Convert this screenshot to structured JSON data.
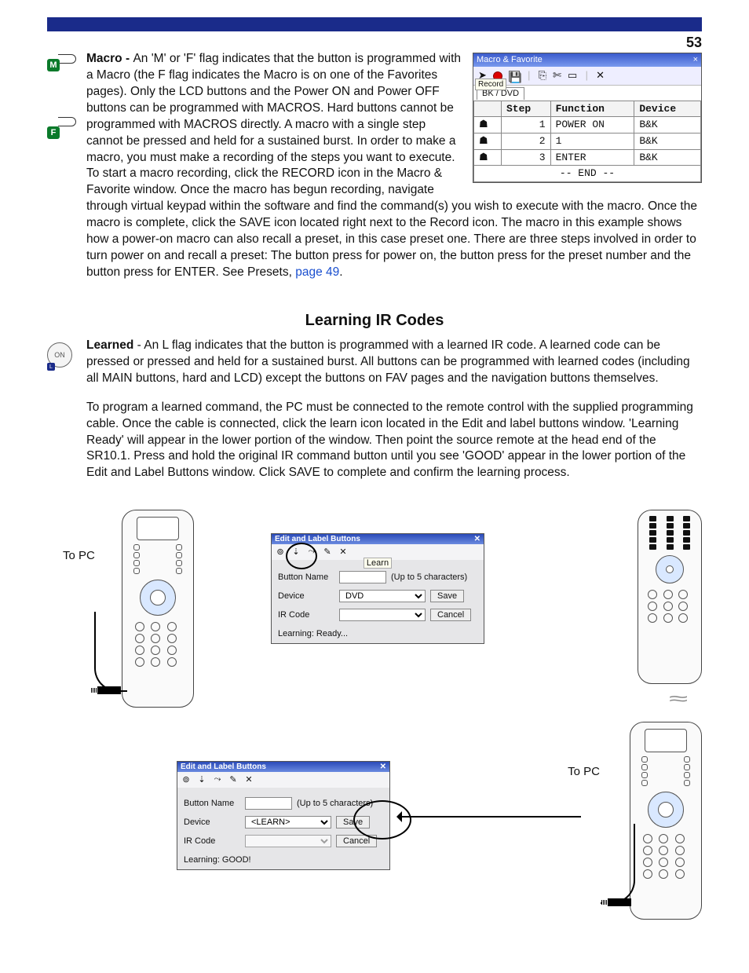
{
  "page_number": "53",
  "macro": {
    "label_m": "M",
    "label_f": "F",
    "heading": "Macro - ",
    "para1": "An 'M' or 'F' flag indicates that the button is programmed with a Macro (the F flag indicates the Macro is on one of the Favorites pages). Only the LCD buttons and the Power ON and Power OFF buttons can be programmed with MACROS. Hard buttons cannot be programmed with MACROS directly.  A macro with a single step cannot be pressed and held for a sustained burst.  In order to make a macro, you must make a recording of the steps you want to execute. To start a macro recording, click the RECORD icon in the Macro & Favorite window.  Once the macro has begun recording, navigate through virtual keypad within the software and find the command(s) you wish to execute with the macro.  Once the macro is complete, click the SAVE icon located right next to the Record icon.  The macro in this example shows how a power-on macro can also recall a preset, in this case preset one. There are three steps involved in order to turn power on and recall a preset: The button press for power on, the button press for the preset number and the button press for ENTER.   See Presets, ",
    "link": "page 49",
    "period": "."
  },
  "macro_window": {
    "title": "Macro & Favorite",
    "close": "×",
    "tip": "Record",
    "tab": "BK / DVD",
    "headers": {
      "step": "Step",
      "func": "Function",
      "dev": "Device"
    },
    "rows": [
      {
        "step": "1",
        "func": "POWER ON",
        "dev": "B&K"
      },
      {
        "step": "2",
        "func": "1",
        "dev": "B&K"
      },
      {
        "step": "3",
        "func": "ENTER",
        "dev": "B&K"
      }
    ],
    "end": "-- END --"
  },
  "learning": {
    "title": "Learning IR Codes",
    "on_label": "ON",
    "l_label": "L",
    "heading": "Learned",
    "para1": " - An L flag indicates that the button is programmed with a learned IR code.  A learned code can be pressed or pressed and held for a sustained burst.  All buttons can be programmed with learned codes (including all MAIN buttons, hard and LCD) except the buttons on FAV pages and the navigation buttons themselves.",
    "para2": "To program a learned command, the PC must be connected to the remote control with the supplied programming cable.  Once the cable is connected, click the learn icon located in the Edit and label buttons window.  'Learning Ready' will appear in the lower portion of the window. Then point the source remote at the head end of the SR10.1.  Press and hold the original IR command button until you see 'GOOD' appear in the lower portion of the Edit and Label Buttons window.  Click SAVE to complete and confirm the learning process."
  },
  "to_pc": "To PC",
  "panel1": {
    "title": "Edit and Label Buttons",
    "learn_tip": "Learn",
    "button_name": "Button Name",
    "upto": "(Up to 5 characters)",
    "device": "Device",
    "device_val": "DVD",
    "ircode": "IR Code",
    "save": "Save",
    "cancel": "Cancel",
    "status": "Learning: Ready..."
  },
  "panel2": {
    "title": "Edit and Label Buttons",
    "button_name": "Button Name",
    "upto": "(Up to 5 characters)",
    "device": "Device",
    "device_val": "<LEARN>",
    "ircode": "IR Code",
    "save": "Save",
    "cancel": "Cancel",
    "status": "Learning: GOOD!"
  }
}
